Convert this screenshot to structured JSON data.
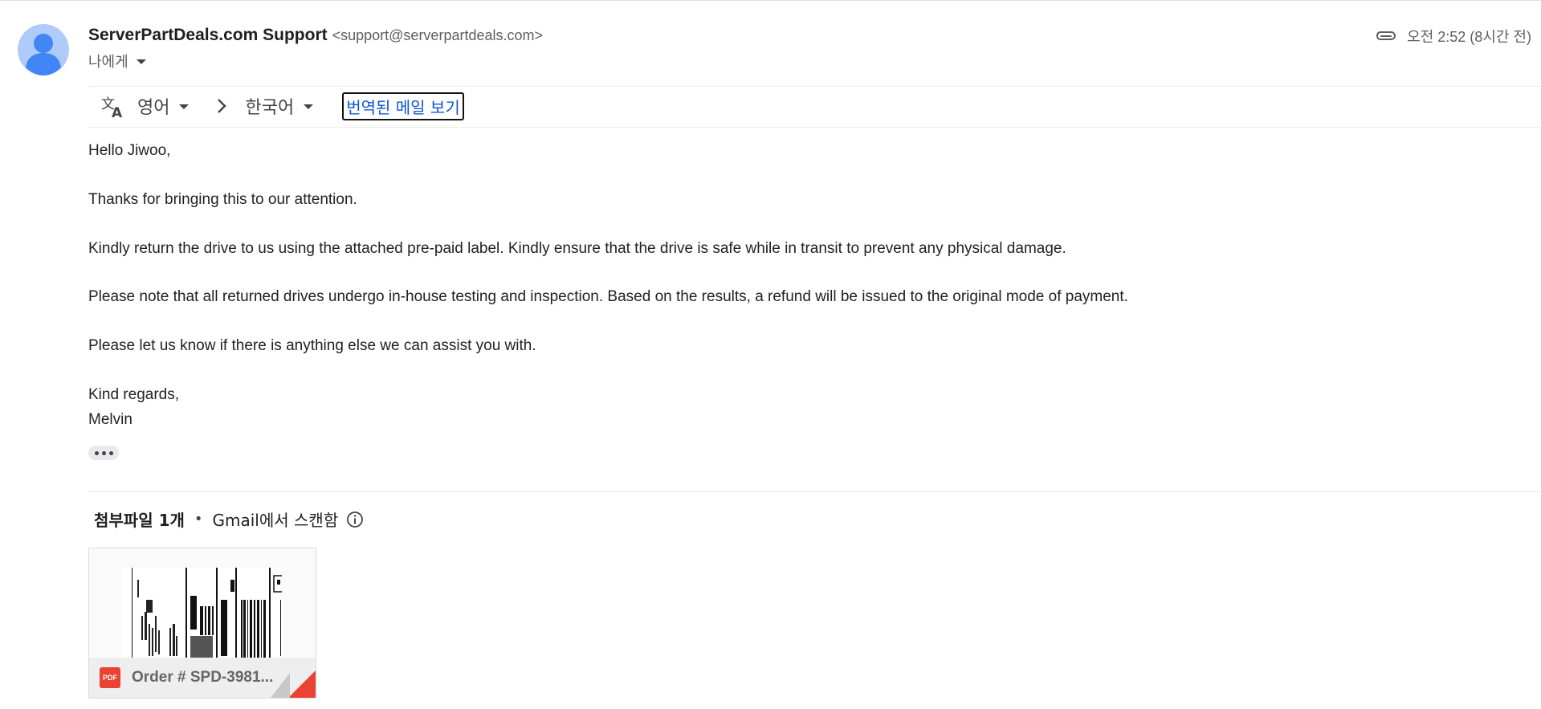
{
  "sender": {
    "name": "ServerPartDeals.com Support",
    "email": "<support@serverpartdeals.com>",
    "recipient_label": "나에게"
  },
  "meta": {
    "time": "오전 2:52 (8시간 전)"
  },
  "translate_bar": {
    "source_lang": "영어",
    "target_lang": "한국어",
    "view_translated_label": "번역된 메일 보기"
  },
  "message": {
    "greeting": "Hello Jiwoo,",
    "line1": "Thanks for bringing this to our attention.",
    "line2": "Kindly return the drive to us using the attached pre-paid label. Kindly ensure that the drive is safe while in transit to prevent any physical damage.",
    "line3": "Please note that all returned drives undergo in-house testing and inspection. Based on the results, a refund will be issued to the original mode of payment.",
    "line4": "Please let us know if there is anything else we can assist you with.",
    "closing": "Kind regards,",
    "signature": "Melvin"
  },
  "attachments": {
    "count_label": "첨부파일 1개",
    "separator": "•",
    "scan_label": "Gmail에서 스캔함",
    "files": [
      {
        "name": "Order # SPD-3981...",
        "type_badge": "PDF"
      }
    ]
  },
  "colors": {
    "link_blue": "#0b57d0",
    "avatar_blue": "#4285f4",
    "pdf_red": "#ea4335"
  },
  "icons": {
    "avatar": "default-avatar-icon",
    "attachment": "paperclip-icon",
    "translate": "translate-icon",
    "info": "info-icon"
  }
}
